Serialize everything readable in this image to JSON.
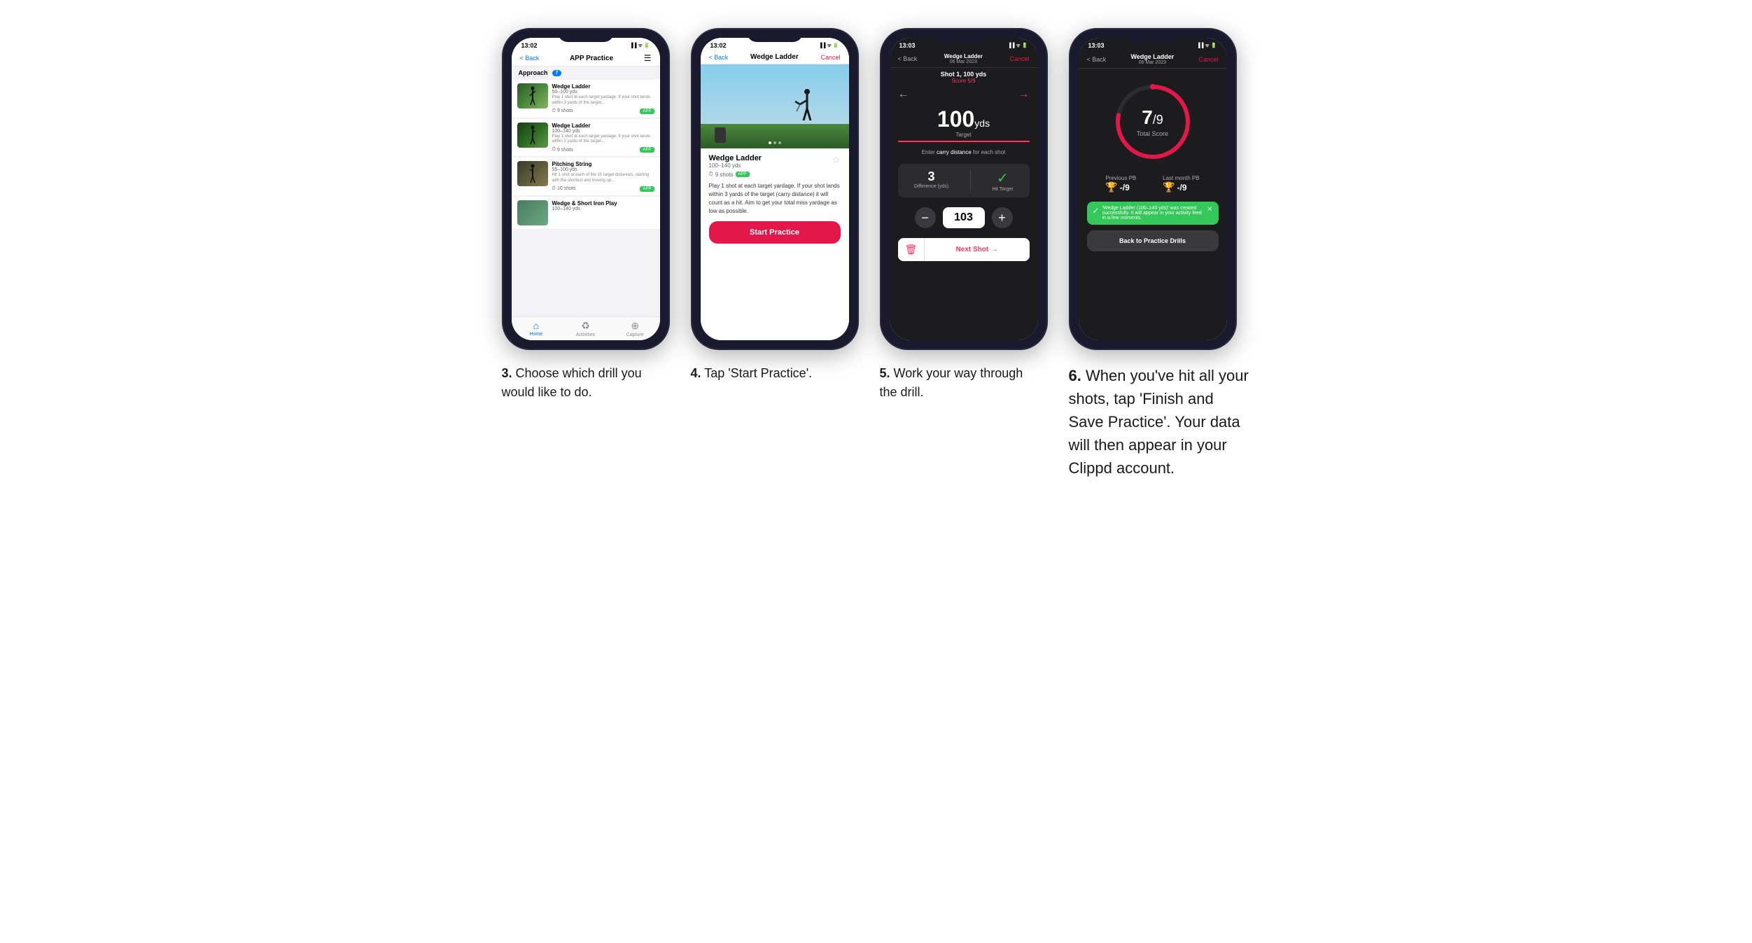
{
  "phones": [
    {
      "id": "phone3",
      "status_time": "13:02",
      "screen_type": "practice_list",
      "nav": {
        "back": "< Back",
        "title": "APP Practice",
        "action": "☰"
      },
      "section": "Approach",
      "section_badge": "7",
      "drills": [
        {
          "name": "Wedge Ladder",
          "range": "50–100 yds",
          "desc": "Play 1 shot at each target yardage. If your shot lands within 3 yards of the target...",
          "shots": "9 shots",
          "badge": "APP"
        },
        {
          "name": "Wedge Ladder",
          "range": "100–140 yds",
          "desc": "Play 1 shot at each target yardage. If your shot lands within 3 yards of the target...",
          "shots": "9 shots",
          "badge": "APP"
        },
        {
          "name": "Pitching String",
          "range": "55–100 yds",
          "desc": "Hit 1 shot at each of the 10 target distances, starting with the shortest and moving up...",
          "shots": "10 shots",
          "badge": "APP"
        },
        {
          "name": "Wedge & Short Iron Play",
          "range": "100–140 yds",
          "desc": "",
          "shots": "",
          "badge": ""
        }
      ],
      "bottom_nav": [
        "Home",
        "Activities",
        "Capture"
      ]
    },
    {
      "id": "phone4",
      "status_time": "13:02",
      "screen_type": "drill_detail",
      "nav": {
        "back": "< Back",
        "title": "Wedge Ladder",
        "cancel": "Cancel"
      },
      "drill": {
        "name": "Wedge Ladder",
        "range": "100–140 yds",
        "shots": "9 shots",
        "badge": "APP",
        "desc": "Play 1 shot at each target yardage. If your shot lands within 3 yards of the target (carry distance) it will count as a hit. Aim to get your total miss yardage as low as possible.",
        "start_btn": "Start Practice"
      }
    },
    {
      "id": "phone5",
      "status_time": "13:03",
      "screen_type": "shot_entry",
      "nav": {
        "back": "< Back",
        "title": "Wedge Ladder",
        "subtitle": "06 Mar 2023",
        "cancel": "Cancel"
      },
      "shot": {
        "label": "Shot 1, 100 yds",
        "score": "Score 5/9",
        "instruction_pre": "Enter ",
        "instruction_em": "carry distance",
        "instruction_post": " for each shot",
        "target": "100",
        "unit": "yds",
        "target_label": "Target",
        "difference": "3",
        "difference_label": "Difference (yds)",
        "hit_target": "Hit Target",
        "value": "103",
        "next_shot": "Next Shot"
      }
    },
    {
      "id": "phone6",
      "status_time": "13:03",
      "screen_type": "score",
      "nav": {
        "back": "< Back",
        "title": "Wedge Ladder",
        "subtitle": "06 Mar 2023",
        "cancel": "Cancel"
      },
      "score": {
        "value": "7",
        "denom": "/9",
        "label": "Total Score"
      },
      "pb": {
        "previous_label": "Previous PB",
        "previous_value": "-/9",
        "last_month_label": "Last month PB",
        "last_month_value": "-/9"
      },
      "toast": "'Wedge Ladder (100–140 yds)' was created successfully. It will appear in your activity feed in a few moments.",
      "back_btn": "Back to Practice Drills"
    }
  ],
  "captions": [
    {
      "number": "3.",
      "text": "Choose which drill you would like to do."
    },
    {
      "number": "4.",
      "text": "Tap 'Start Practice'."
    },
    {
      "number": "5.",
      "text": "Work your way through the drill."
    },
    {
      "number": "6.",
      "text": "When you've hit all your shots, tap 'Finish and Save Practice'. Your data will then appear in your Clippd account."
    }
  ]
}
